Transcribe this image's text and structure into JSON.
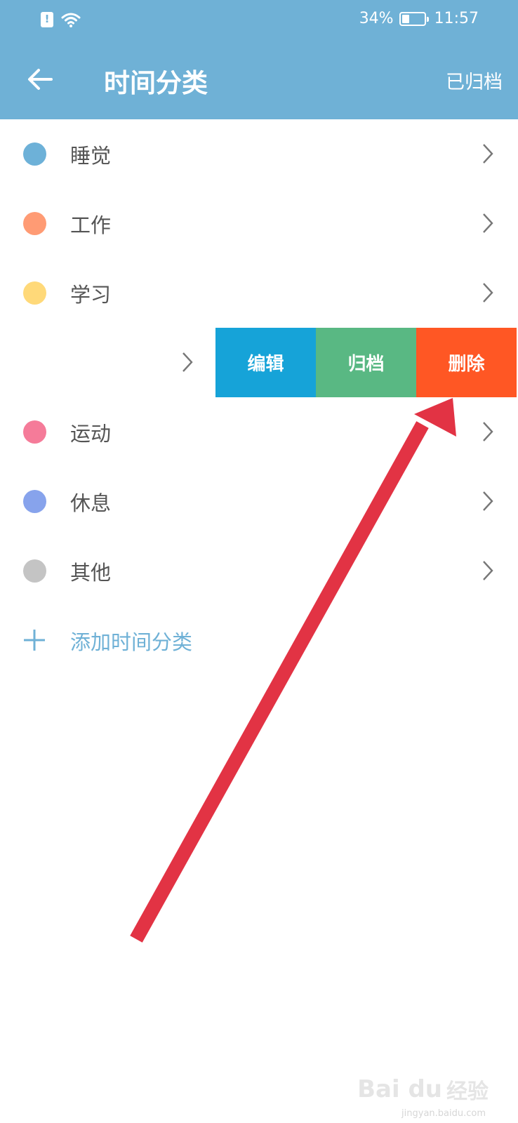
{
  "status_bar": {
    "battery_percent": "34%",
    "time": "11:57",
    "battery_level": 0.34
  },
  "header": {
    "title": "时间分类",
    "archived_label": "已归档"
  },
  "categories": [
    {
      "label": "睡觉",
      "color": "#6db1d8"
    },
    {
      "label": "工作",
      "color": "#ff9b74"
    },
    {
      "label": "学习",
      "color": "#ffd979"
    },
    {
      "label": "",
      "color": ""
    },
    {
      "label": "运动",
      "color": "#f57b99"
    },
    {
      "label": "休息",
      "color": "#87a3ec"
    },
    {
      "label": "其他",
      "color": "#c4c4c4"
    }
  ],
  "swipe_actions": {
    "edit": {
      "label": "编辑",
      "color": "#16a3d8"
    },
    "archive": {
      "label": "归档",
      "color": "#59b883"
    },
    "delete": {
      "label": "删除",
      "color": "#ff5724"
    }
  },
  "add_category_label": "添加时间分类",
  "colors": {
    "header": "#6fb1d6",
    "annotation_arrow": "#e23344"
  },
  "watermark": {
    "logo": "Bai du",
    "text": "经验",
    "url": "jingyan.baidu.com"
  }
}
